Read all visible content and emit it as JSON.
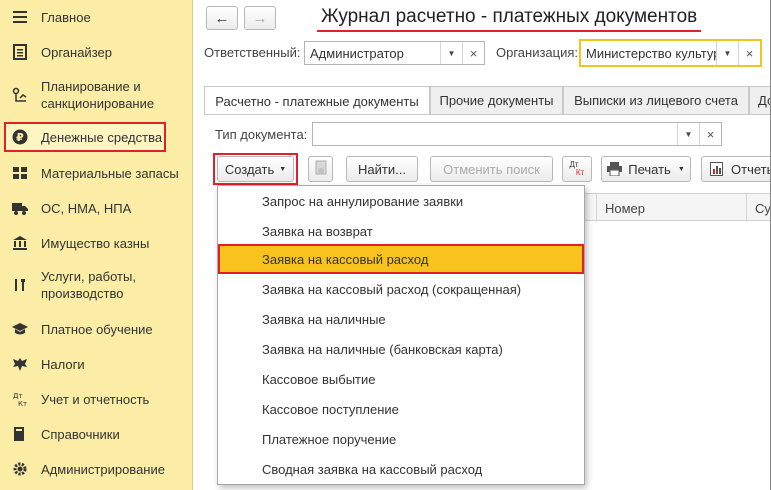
{
  "sidebar": {
    "items": [
      {
        "label": "Главное",
        "icon": "hamburger-icon"
      },
      {
        "label": "Органайзер",
        "icon": "clipboard-icon"
      },
      {
        "label": "Планирование и санкционирование",
        "icon": "planning-icon"
      },
      {
        "label": "Денежные средства",
        "icon": "ruble-coin-icon"
      },
      {
        "label": "Материальные запасы",
        "icon": "boxes-icon"
      },
      {
        "label": "ОС, НМА, НПА",
        "icon": "truck-icon"
      },
      {
        "label": "Имущество казны",
        "icon": "bank-building-icon"
      },
      {
        "label": "Услуги, работы, производство",
        "icon": "tools-icon"
      },
      {
        "label": "Платное обучение",
        "icon": "graduation-cap-icon"
      },
      {
        "label": "Налоги",
        "icon": "eagle-emblem-icon"
      },
      {
        "label": "Учет и отчетность",
        "icon": "debit-credit-icon"
      },
      {
        "label": "Справочники",
        "icon": "books-icon"
      },
      {
        "label": "Администрирование",
        "icon": "gear-icon"
      }
    ]
  },
  "header": {
    "title": "Журнал расчетно - платежных документов"
  },
  "filters": {
    "responsible_label": "Ответственный:",
    "responsible_value": "Администратор",
    "organization_label": "Организация:",
    "organization_value": "Министерство культур",
    "doc_type_label": "Тип документа:",
    "doc_type_value": ""
  },
  "tabs": [
    {
      "label": "Расчетно - платежные документы"
    },
    {
      "label": "Прочие документы"
    },
    {
      "label": "Выписки из лицевого счета"
    },
    {
      "label": "До"
    }
  ],
  "toolbar": {
    "create_label": "Создать",
    "find_label": "Найти...",
    "cancel_search_label": "Отменить поиск",
    "dtkt_label_top": "Дт",
    "dtkt_label_bottom": "Кт",
    "print_label": "Печать",
    "reports_label": "Отчеты"
  },
  "table": {
    "columns": [
      "Номер",
      "Су"
    ]
  },
  "create_menu": {
    "items": [
      "Запрос на аннулирование заявки",
      "Заявка на возврат",
      "Заявка на кассовый расход",
      "Заявка на кассовый расход (сокращенная)",
      "Заявка на наличные",
      "Заявка на наличные (банковская карта)",
      "Кассовое выбытие",
      "Кассовое поступление",
      "Платежное поручение",
      "Сводная заявка на кассовый расход"
    ],
    "selected_index": 2
  },
  "colors": {
    "sidebar_bg": "#fbeda6",
    "highlight_red": "#e0202a",
    "selected_yellow": "#f8c31c"
  }
}
